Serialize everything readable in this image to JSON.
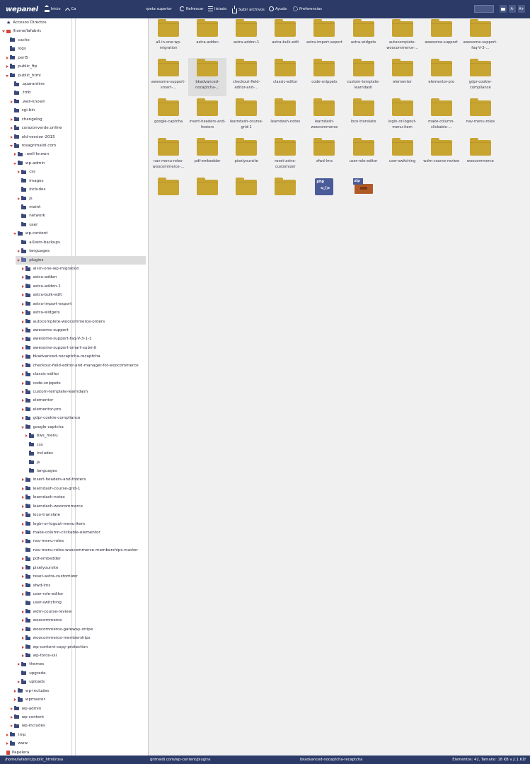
{
  "topbar": {
    "logo": "wepanel",
    "inicio": "Inicio",
    "carpeta_truncated": "Ca",
    "carpeta_superior": "rpeta superior",
    "refrescar": "Refrescar",
    "listado": "listado",
    "subir": "Subir archivos",
    "ayuda": "Ayuda",
    "preferencias": "Preferencias",
    "btn_a_minus": "A-",
    "btn_a_plus": "A+"
  },
  "tree": [
    {
      "label": "Accesos Directos",
      "icon": "star-icon",
      "indent": 0,
      "arrow": "none"
    },
    {
      "label": "/home/lafabric",
      "icon": "home-icon",
      "indent": 0,
      "arrow": "down"
    },
    {
      "label": "cache",
      "indent": 1,
      "arrow": "none"
    },
    {
      "label": "logs",
      "indent": 1,
      "arrow": "none"
    },
    {
      "label": "perl5",
      "indent": 1,
      "arrow": "right"
    },
    {
      "label": "public_ftp",
      "indent": 1,
      "arrow": "right"
    },
    {
      "label": "public_html",
      "indent": 1,
      "arrow": "down"
    },
    {
      "label": ".quarantine",
      "indent": 2,
      "arrow": "none"
    },
    {
      "label": ".tmb",
      "indent": 2,
      "arrow": "none"
    },
    {
      "label": ".well-known",
      "indent": 2,
      "arrow": "right"
    },
    {
      "label": "cgi-bin",
      "indent": 2,
      "arrow": "none"
    },
    {
      "label": "changelog",
      "indent": 2,
      "arrow": "right"
    },
    {
      "label": "corazonverde.online",
      "indent": 2,
      "arrow": "right"
    },
    {
      "label": "old-version-2015",
      "indent": 2,
      "arrow": "right"
    },
    {
      "label": "rosagrimaldi.com",
      "indent": 2,
      "arrow": "down"
    },
    {
      "label": ".well-known",
      "indent": 3,
      "arrow": "right"
    },
    {
      "label": "wp-admin",
      "indent": 3,
      "arrow": "down"
    },
    {
      "label": "css",
      "indent": 4,
      "arrow": "right"
    },
    {
      "label": "images",
      "indent": 4,
      "arrow": "none"
    },
    {
      "label": "includes",
      "indent": 4,
      "arrow": "none"
    },
    {
      "label": "js",
      "indent": 4,
      "arrow": "right"
    },
    {
      "label": "maint",
      "indent": 4,
      "arrow": "none"
    },
    {
      "label": "network",
      "indent": 4,
      "arrow": "none"
    },
    {
      "label": "user",
      "indent": 4,
      "arrow": "none"
    },
    {
      "label": "wp-content",
      "indent": 3,
      "arrow": "down"
    },
    {
      "label": "ai1wm-backups",
      "indent": 4,
      "arrow": "none"
    },
    {
      "label": "languages",
      "indent": 4,
      "arrow": "right"
    },
    {
      "label": "plugins",
      "indent": 4,
      "arrow": "down",
      "selected": true,
      "open": true
    },
    {
      "label": "all-in-one-wp-migration",
      "indent": 5,
      "arrow": "right"
    },
    {
      "label": "astra-addon",
      "indent": 5,
      "arrow": "right"
    },
    {
      "label": "astra-addon-1",
      "indent": 5,
      "arrow": "right"
    },
    {
      "label": "astra-bulk-edit",
      "indent": 5,
      "arrow": "right"
    },
    {
      "label": "astra-import-export",
      "indent": 5,
      "arrow": "right"
    },
    {
      "label": "astra-widgets",
      "indent": 5,
      "arrow": "right"
    },
    {
      "label": "autocomplete-woocommerce-orders",
      "indent": 5,
      "arrow": "right"
    },
    {
      "label": "awesome-support",
      "indent": 5,
      "arrow": "right"
    },
    {
      "label": "awesome-support-faq-V-3-1-1",
      "indent": 5,
      "arrow": "right"
    },
    {
      "label": "awesome-support-smart-submit",
      "indent": 5,
      "arrow": "right"
    },
    {
      "label": "bkadvanced-nocaptcha-recaptcha",
      "indent": 5,
      "arrow": "right"
    },
    {
      "label": "checkout-field-editor-and-manager-for-woocommerce",
      "indent": 5,
      "arrow": "right"
    },
    {
      "label": "classic-editor",
      "indent": 5,
      "arrow": "right"
    },
    {
      "label": "code-snippets",
      "indent": 5,
      "arrow": "right"
    },
    {
      "label": "custom-template-learndash",
      "indent": 5,
      "arrow": "right"
    },
    {
      "label": "elementor",
      "indent": 5,
      "arrow": "right"
    },
    {
      "label": "elementor-pro",
      "indent": 5,
      "arrow": "right"
    },
    {
      "label": "gdpr-cookie-compliance",
      "indent": 5,
      "arrow": "right"
    },
    {
      "label": "google-captcha",
      "indent": 5,
      "arrow": "down"
    },
    {
      "label": "bws_menu",
      "indent": 6,
      "arrow": "right"
    },
    {
      "label": "css",
      "indent": 6,
      "arrow": "none"
    },
    {
      "label": "includes",
      "indent": 6,
      "arrow": "none"
    },
    {
      "label": "js",
      "indent": 6,
      "arrow": "none"
    },
    {
      "label": "languages",
      "indent": 6,
      "arrow": "none"
    },
    {
      "label": "insert-headers-and-footers",
      "indent": 5,
      "arrow": "right"
    },
    {
      "label": "learndash-course-grid-1",
      "indent": 5,
      "arrow": "right"
    },
    {
      "label": "learndash-notes",
      "indent": 5,
      "arrow": "right"
    },
    {
      "label": "learndash-woocommerce",
      "indent": 5,
      "arrow": "right"
    },
    {
      "label": "loco-translate",
      "indent": 5,
      "arrow": "right"
    },
    {
      "label": "login-or-logout-menu-item",
      "indent": 5,
      "arrow": "right"
    },
    {
      "label": "make-column-clickable-elementor",
      "indent": 5,
      "arrow": "right"
    },
    {
      "label": "nav-menu-roles",
      "indent": 5,
      "arrow": "right"
    },
    {
      "label": "nav-menu-roles-woocommerce-memberships-master",
      "indent": 5,
      "arrow": "none"
    },
    {
      "label": "pdf-embedder",
      "indent": 5,
      "arrow": "right"
    },
    {
      "label": "pixelyoursite",
      "indent": 5,
      "arrow": "right"
    },
    {
      "label": "reset-astra-customizer",
      "indent": 5,
      "arrow": "right"
    },
    {
      "label": "sfwd-lms",
      "indent": 5,
      "arrow": "right"
    },
    {
      "label": "user-role-editor",
      "indent": 5,
      "arrow": "right"
    },
    {
      "label": "user-switching",
      "indent": 5,
      "arrow": "none"
    },
    {
      "label": "wdm-course-review",
      "indent": 5,
      "arrow": "right"
    },
    {
      "label": "woocommerce",
      "indent": 5,
      "arrow": "right"
    },
    {
      "label": "woocommerce-gateway-stripe",
      "indent": 5,
      "arrow": "right"
    },
    {
      "label": "woocommerce-memberships",
      "indent": 5,
      "arrow": "right"
    },
    {
      "label": "wp-content-copy-protection",
      "indent": 5,
      "arrow": "right"
    },
    {
      "label": "wp-force-ssl",
      "indent": 5,
      "arrow": "right"
    },
    {
      "label": "themes",
      "indent": 4,
      "arrow": "right"
    },
    {
      "label": "upgrade",
      "indent": 4,
      "arrow": "none"
    },
    {
      "label": "uploads",
      "indent": 4,
      "arrow": "right"
    },
    {
      "label": "wp-includes",
      "indent": 3,
      "arrow": "right"
    },
    {
      "label": "wpmaster",
      "indent": 3,
      "arrow": "right"
    },
    {
      "label": "wp-admin",
      "indent": 2,
      "arrow": "right"
    },
    {
      "label": "wp-content",
      "indent": 2,
      "arrow": "right"
    },
    {
      "label": "wp-includes",
      "indent": 2,
      "arrow": "right"
    },
    {
      "label": "tmp",
      "indent": 1,
      "arrow": "right"
    },
    {
      "label": "www",
      "indent": 1,
      "arrow": "right"
    },
    {
      "label": "Papelera",
      "icon": "trash-icon",
      "indent": 0,
      "arrow": "none"
    }
  ],
  "files": [
    {
      "label": "all-in-one-wp-migration",
      "type": "folder"
    },
    {
      "label": "astra-addon",
      "type": "folder"
    },
    {
      "label": "astra-addon-1",
      "type": "folder"
    },
    {
      "label": "astra-bulk-edit",
      "type": "folder"
    },
    {
      "label": "astra-import-export",
      "type": "folder"
    },
    {
      "label": "astra-widgets",
      "type": "folder"
    },
    {
      "label": "autocomplete-woocommerce-...",
      "type": "folder"
    },
    {
      "label": "awesome-support",
      "type": "folder"
    },
    {
      "label": "awesome-support-faq-V-3-...",
      "type": "folder"
    },
    {
      "label": "awesome-support-smart-...",
      "type": "folder"
    },
    {
      "label": "bkadvanced-nocaptcha-...",
      "type": "folder",
      "selected": true
    },
    {
      "label": "checkout-field-editor-and-...",
      "type": "folder"
    },
    {
      "label": "classic-editor",
      "type": "folder"
    },
    {
      "label": "code-snippets",
      "type": "folder"
    },
    {
      "label": "custom-template-learndash",
      "type": "folder"
    },
    {
      "label": "elementor",
      "type": "folder"
    },
    {
      "label": "elementor-pro",
      "type": "folder"
    },
    {
      "label": "gdpr-cookie-compliance",
      "type": "folder"
    },
    {
      "label": "google-captcha",
      "type": "folder"
    },
    {
      "label": "insert-headers-and-footers",
      "type": "folder"
    },
    {
      "label": "learndash-course-grid-1",
      "type": "folder"
    },
    {
      "label": "learndash-notes",
      "type": "folder"
    },
    {
      "label": "learndash-woocommerce",
      "type": "folder"
    },
    {
      "label": "loco-translate",
      "type": "folder"
    },
    {
      "label": "login-or-logout-menu-item",
      "type": "folder"
    },
    {
      "label": "make-column-clickable-...",
      "type": "folder"
    },
    {
      "label": "nav-menu-roles",
      "type": "folder"
    },
    {
      "label": "nav-menu-roles-woocommerce-...",
      "type": "folder"
    },
    {
      "label": "pdf-embedder",
      "type": "folder"
    },
    {
      "label": "pixelyoursite",
      "type": "folder"
    },
    {
      "label": "reset-astra-customizer",
      "type": "folder"
    },
    {
      "label": "sfwd-lms",
      "type": "folder"
    },
    {
      "label": "user-role-editor",
      "type": "folder"
    },
    {
      "label": "user-switching",
      "type": "folder"
    },
    {
      "label": "wdm-course-review",
      "type": "folder"
    },
    {
      "label": "woocommerce",
      "type": "folder"
    },
    {
      "label": "",
      "type": "folder"
    },
    {
      "label": "",
      "type": "folder"
    },
    {
      "label": "",
      "type": "folder"
    },
    {
      "label": "",
      "type": "folder"
    },
    {
      "label": "php",
      "type": "php"
    },
    {
      "label": "zip",
      "type": "zip"
    }
  ],
  "statusbar": {
    "path_left": "/home/lafabric/public_html/rosa",
    "path_mid": "grimaldi.com/wp-content/plugins",
    "selected": "bkadvanced-nocaptcha-recaptcha",
    "summary": "Elementos: 42, Tamaño: 18 KB v.2.1.61f"
  },
  "colors": {
    "topbar": "#2b3a67",
    "folder": "#c8a430",
    "tree_folder": "#3b4a7a",
    "arrow": "#d4453b"
  }
}
